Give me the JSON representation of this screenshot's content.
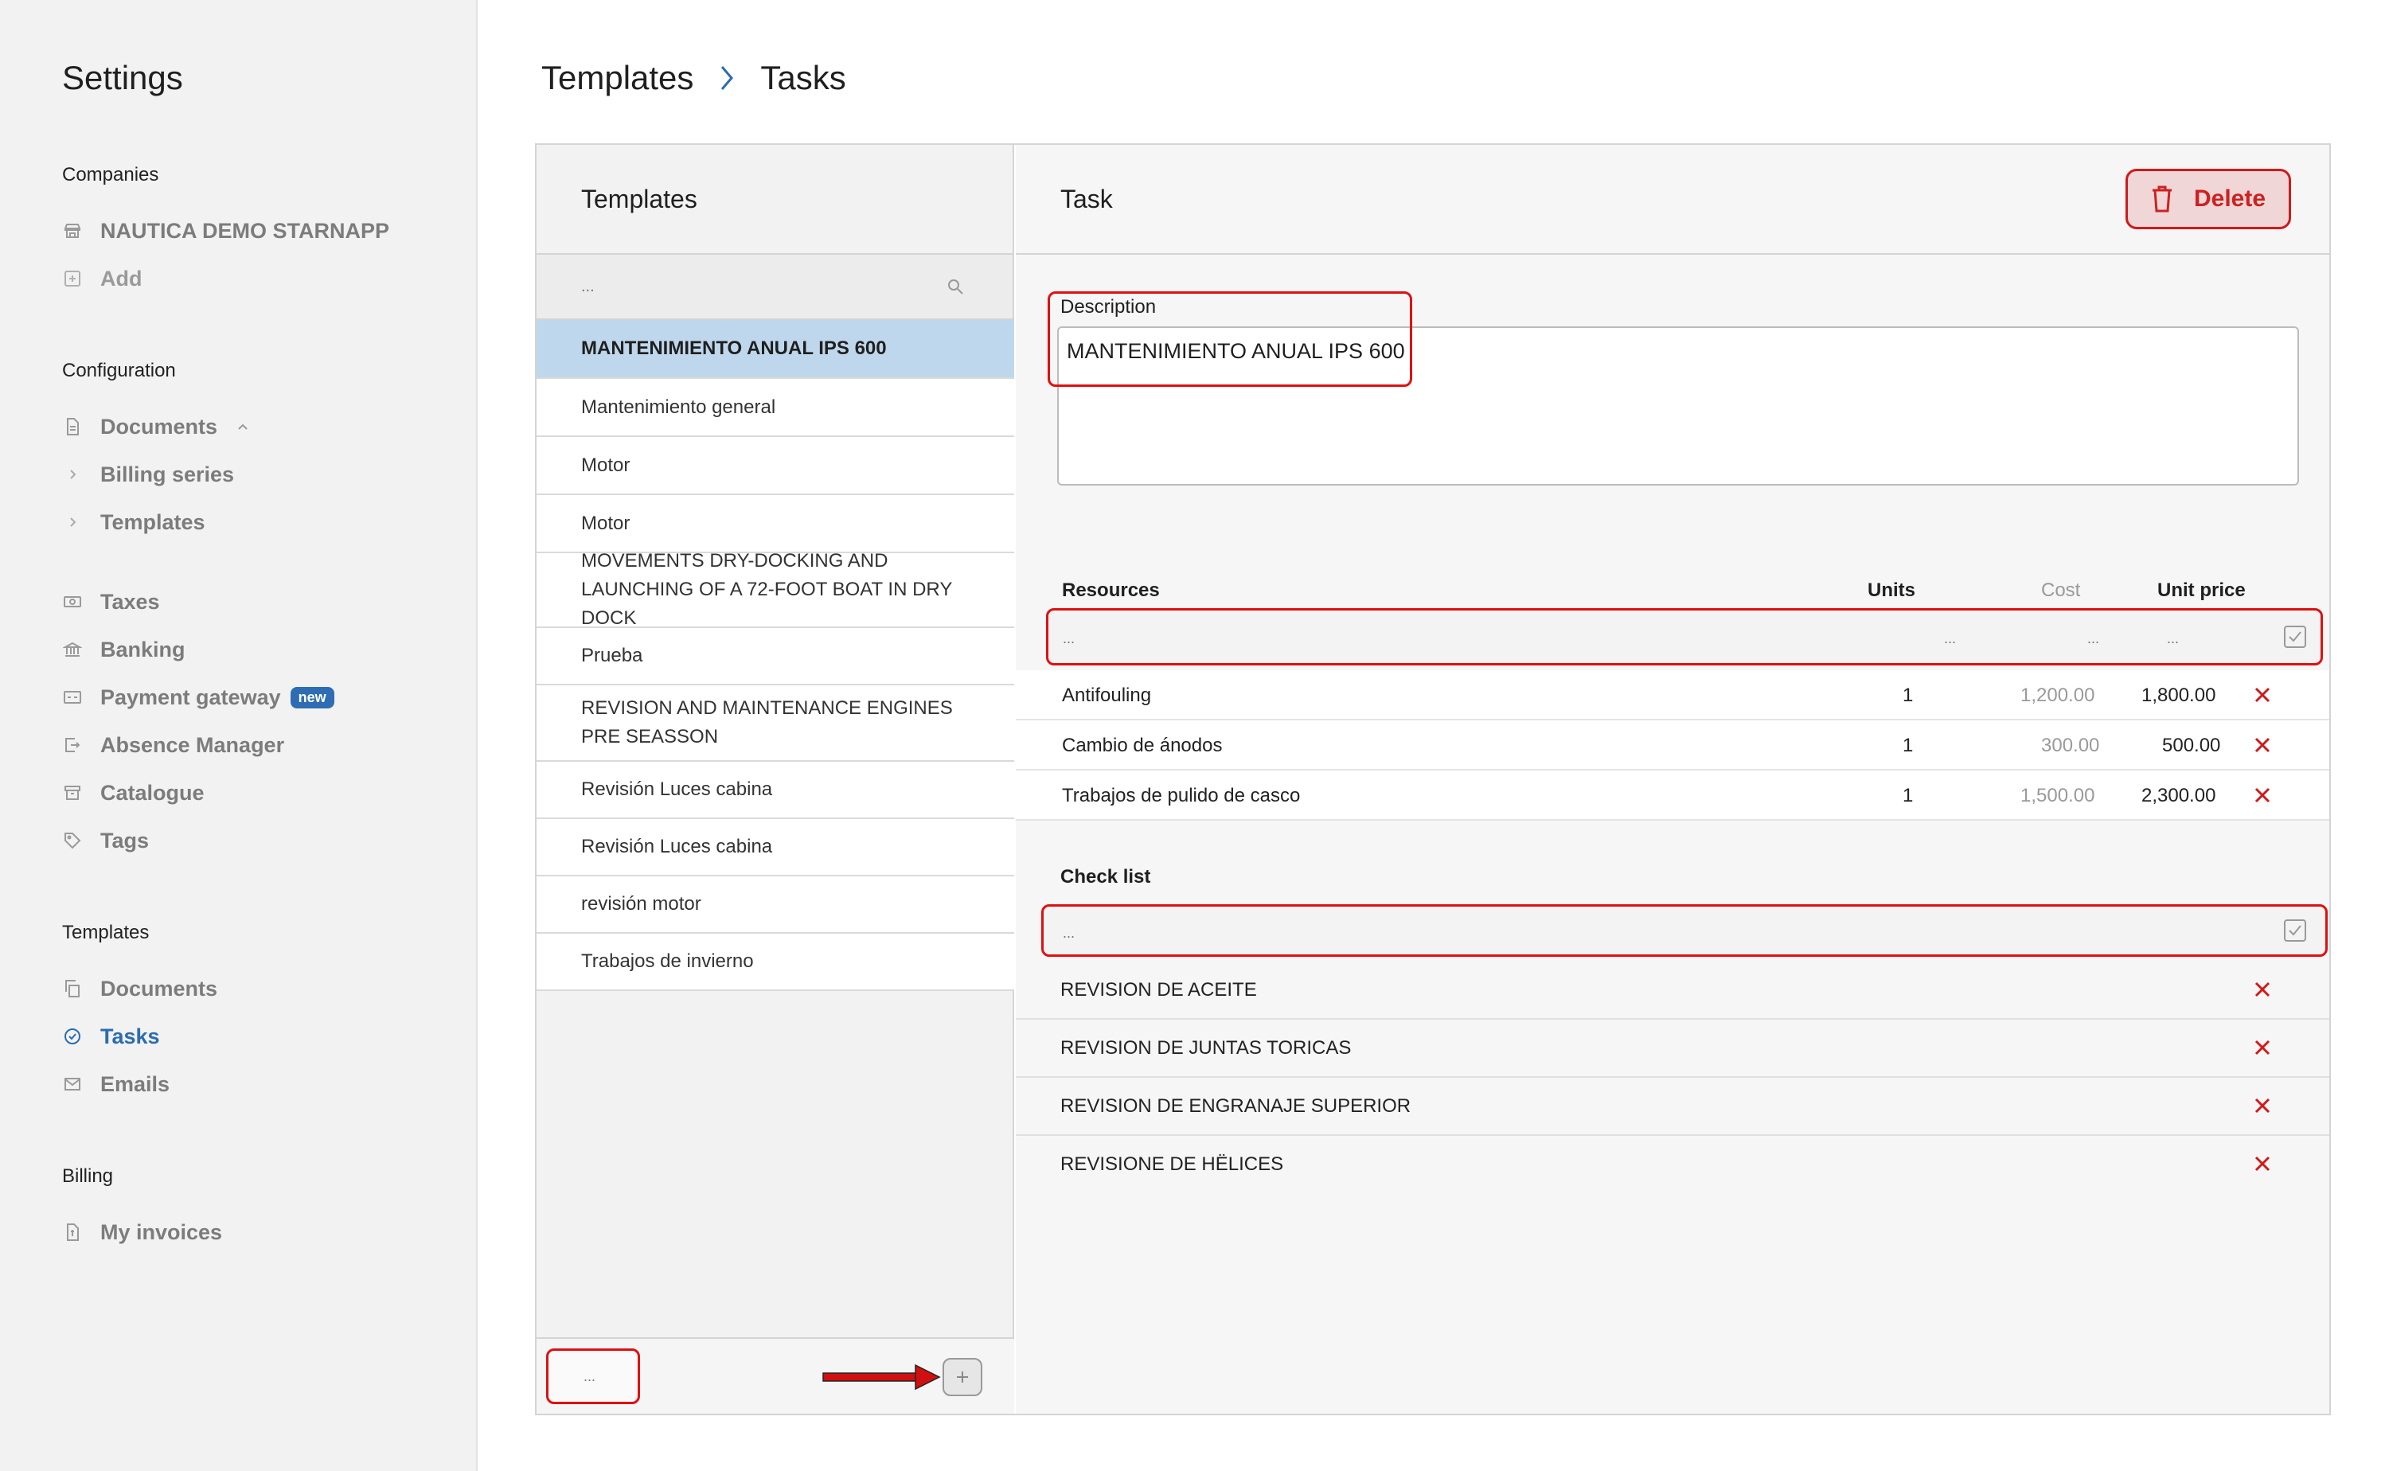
{
  "sidebar": {
    "title": "Settings",
    "sections": {
      "companies": "Companies",
      "configuration": "Configuration",
      "templates": "Templates",
      "billing": "Billing"
    },
    "companies": [
      "NAUTICA DEMO STARNAPP",
      "Add"
    ],
    "configuration": {
      "documents": "Documents",
      "billing_series": "Billing series",
      "templates": "Templates",
      "taxes": "Taxes",
      "banking": "Banking",
      "payment_gateway": "Payment gateway",
      "new_badge": "new",
      "absence_manager": "Absence Manager",
      "catalogue": "Catalogue",
      "tags": "Tags"
    },
    "templates": {
      "documents": "Documents",
      "tasks": "Tasks",
      "emails": "Emails"
    },
    "billing": {
      "my_invoices": "My invoices"
    },
    "active_color": "#2b6cb0"
  },
  "breadcrumb": [
    "Templates",
    "Tasks"
  ],
  "list": {
    "header": "Templates",
    "search_placeholder": "...",
    "items": [
      "MANTENIMIENTO ANUAL IPS 600",
      "Mantenimiento general",
      "Motor",
      "Motor",
      "MOVEMENTS DRY-DOCKING AND LAUNCHING OF A 72-FOOT BOAT IN DRY DOCK",
      "Prueba",
      "REVISION AND MAINTENANCE ENGINES PRE SEASSON",
      "Revisión Luces cabina",
      "Revisión Luces cabina",
      "revisión motor",
      "Trabajos de invierno"
    ],
    "new_placeholder": "..."
  },
  "detail": {
    "header": "Task",
    "delete_label": "Delete",
    "description_label": "Description",
    "description_value": "MANTENIMIENTO ANUAL IPS 600",
    "resources": {
      "headers": {
        "resource": "Resources",
        "units": "Units",
        "cost": "Cost",
        "unit_price": "Unit price"
      },
      "new_placeholder": "...",
      "rows": [
        {
          "name": "Antifouling",
          "units": "1",
          "cost": "1,200.00",
          "price": "1,800.00"
        },
        {
          "name": "Cambio de ánodos",
          "units": "1",
          "cost": "300.00",
          "price": "500.00"
        },
        {
          "name": "Trabajos de pulido de casco",
          "units": "1",
          "cost": "1,500.00",
          "price": "2,300.00"
        }
      ]
    },
    "checklist": {
      "header": "Check list",
      "new_placeholder": "...",
      "items": [
        "REVISION DE ACEITE",
        "REVISION DE JUNTAS TORICAS",
        "REVISION DE ENGRANAJE SUPERIOR",
        "REVISIONE DE HËLICES"
      ]
    }
  },
  "colors": {
    "accent": "#2e6db3",
    "danger": "#cc2222",
    "highlight": "#e01010",
    "selected_row": "#bfd7ec"
  }
}
